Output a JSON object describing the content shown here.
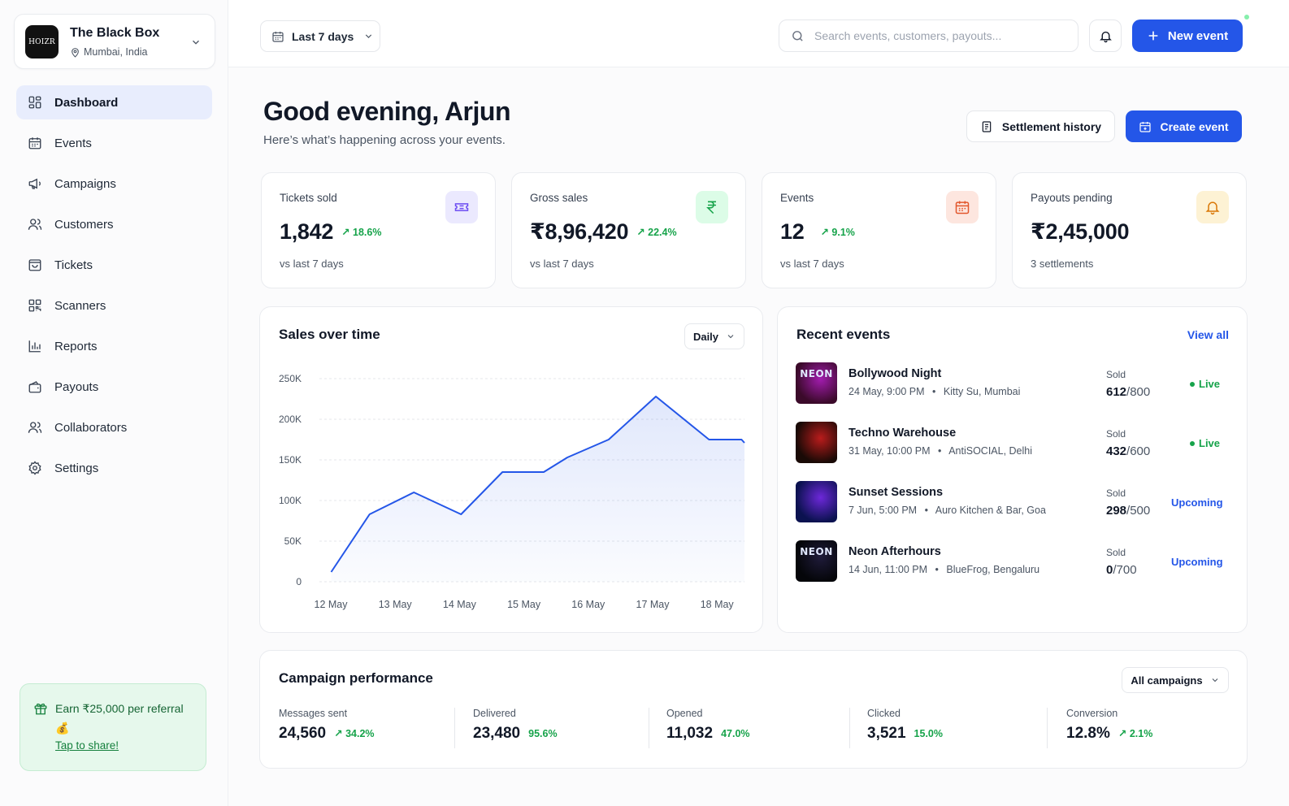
{
  "org": {
    "logo_text": "HOIZR",
    "name": "The Black Box",
    "location": "Mumbai, India"
  },
  "nav": [
    {
      "label": "Dashboard",
      "icon": "grid-icon",
      "active": true
    },
    {
      "label": "Events",
      "icon": "calendar-icon"
    },
    {
      "label": "Campaigns",
      "icon": "megaphone-icon"
    },
    {
      "label": "Customers",
      "icon": "users-icon"
    },
    {
      "label": "Tickets",
      "icon": "ticket-bag-icon"
    },
    {
      "label": "Scanners",
      "icon": "qr-code-icon"
    },
    {
      "label": "Reports",
      "icon": "bar-chart-icon"
    },
    {
      "label": "Payouts",
      "icon": "wallet-icon"
    },
    {
      "label": "Collaborators",
      "icon": "users-icon"
    },
    {
      "label": "Settings",
      "icon": "gear-icon"
    }
  ],
  "referral": {
    "text": "Earn ₹25,000 per referral",
    "emoji": "💰",
    "link": "Tap to share!"
  },
  "topbar": {
    "range_label": "Last 7 days",
    "search_placeholder": "Search events, customers, payouts...",
    "new_event_label": "New event"
  },
  "header": {
    "greeting": "Good evening, Arjun",
    "subtitle": "Here’s what’s happening across your events.",
    "settlement_label": "Settlement history",
    "create_label": "Create event"
  },
  "stats": [
    {
      "label": "Tickets sold",
      "value": "1,842",
      "delta": "18.6%",
      "foot": "vs last 7 days",
      "icon": "ticket-icon"
    },
    {
      "label": "Gross sales",
      "value": "₹8,96,420",
      "delta": "22.4%",
      "foot": "vs last 7 days",
      "icon": "rupee-icon"
    },
    {
      "label": "Events",
      "value": "12",
      "delta": "9.1%",
      "foot": "vs last 7 days",
      "icon": "calendar-icon"
    },
    {
      "label": "Payouts pending",
      "value": "₹2,45,000",
      "delta": "",
      "foot": "3 settlements",
      "icon": "bell-icon"
    }
  ],
  "sales_chart": {
    "title": "Sales over time",
    "granularity": "Daily"
  },
  "chart_data": {
    "type": "area",
    "title": "Sales over time",
    "x": [
      "12 May",
      "13 May",
      "14 May",
      "15 May",
      "16 May",
      "17 May",
      "18 May"
    ],
    "y_ticks": [
      "0",
      "50K",
      "100K",
      "150K",
      "200K",
      "250K"
    ],
    "ylim": [
      0,
      250000
    ],
    "grid": true,
    "accent": "#2456e8",
    "series": [
      {
        "points": [
          {
            "x": 12.0,
            "y": 12000
          },
          {
            "x": 12.65,
            "y": 83000
          },
          {
            "x": 13.4,
            "y": 110000
          },
          {
            "x": 14.2,
            "y": 83000
          },
          {
            "x": 14.9,
            "y": 135000
          },
          {
            "x": 15.6,
            "y": 135000
          },
          {
            "x": 16.0,
            "y": 153000
          },
          {
            "x": 16.7,
            "y": 175000
          },
          {
            "x": 17.5,
            "y": 228000
          },
          {
            "x": 18.4,
            "y": 175000
          },
          {
            "x": 18.95,
            "y": 175000
          },
          {
            "x": 19.0,
            "y": 171000
          }
        ]
      }
    ]
  },
  "recent_events": {
    "title": "Recent events",
    "view_all": "View all",
    "sold_label": "Sold",
    "items": [
      {
        "name": "Bollywood Night",
        "date": "24 May, 9:00 PM",
        "venue": "Kitty Su, Mumbai",
        "sold": "612",
        "capacity": "/800",
        "status": "Live",
        "thumb_colors": [
          "#3b0a2a",
          "#a21caf"
        ],
        "thumb_text": "NEON"
      },
      {
        "name": "Techno Warehouse",
        "date": "31 May, 10:00 PM",
        "venue": "AntiSOCIAL, Delhi",
        "sold": "432",
        "capacity": "/600",
        "status": "Live",
        "thumb_colors": [
          "#1a0a06",
          "#b91c1c"
        ],
        "thumb_text": ""
      },
      {
        "name": "Sunset Sessions",
        "date": "7 Jun, 5:00 PM",
        "venue": "Auro Kitchen & Bar, Goa",
        "sold": "298",
        "capacity": "/500",
        "status": "Upcoming",
        "thumb_colors": [
          "#0b1250",
          "#6d28d9"
        ],
        "thumb_text": ""
      },
      {
        "name": "Neon Afterhours",
        "date": "14 Jun, 11:00 PM",
        "venue": "BlueFrog, Bengaluru",
        "sold": "0",
        "capacity": "/700",
        "status": "Upcoming",
        "thumb_colors": [
          "#05060a",
          "#1f1b3a"
        ],
        "thumb_text": "NEON"
      }
    ]
  },
  "campaigns": {
    "title": "Campaign performance",
    "filter": "All campaigns",
    "metrics": [
      {
        "label": "Messages sent",
        "value": "24,560",
        "delta": "34.2%",
        "arrow": true
      },
      {
        "label": "Delivered",
        "value": "23,480",
        "delta": "95.6%",
        "arrow": false
      },
      {
        "label": "Opened",
        "value": "11,032",
        "delta": "47.0%",
        "arrow": false
      },
      {
        "label": "Clicked",
        "value": "3,521",
        "delta": "15.0%",
        "arrow": false
      },
      {
        "label": "Conversion",
        "value": "12.8%",
        "delta": "2.1%",
        "arrow": true
      }
    ]
  }
}
